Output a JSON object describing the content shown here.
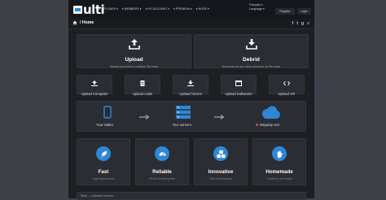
{
  "header": {
    "logo_text": "ulti",
    "nav": [
      "▾ UPLOADS ▾",
      "▾ MEMBERS ▾",
      "▾ MY ACCOUNT ▾",
      "▾ PREMIUM ▾",
      "▾ MORE ▾"
    ],
    "language": [
      "Français ▾",
      "Language ▾"
    ],
    "register_label": "Register",
    "login_label": "Login"
  },
  "breadcrumb": {
    "text": "/ Home"
  },
  "social": [
    "f",
    "t",
    "g",
    "≡"
  ],
  "upload": {
    "title": "Upload",
    "subtitle": "Upload your files to multiple file-hosts"
  },
  "debrid": {
    "title": "Debrid",
    "subtitle": "Download as you were premium on file-hosts"
  },
  "upload_options": [
    {
      "label": "Upload Computer",
      "icon": "upload-icon"
    },
    {
      "label": "Upload Links",
      "icon": "document-icon"
    },
    {
      "label": "Upload Torrent",
      "icon": "download-icon"
    },
    {
      "label": "Upload Softwares",
      "icon": "window-icon"
    },
    {
      "label": "Upload API",
      "icon": "code-icon"
    }
  ],
  "flow": {
    "tablet": "Your tablet",
    "servers": "Our servers",
    "host": "MegaUp.net"
  },
  "features": [
    {
      "title": "Fast",
      "subtitle": "Huge infrastructure",
      "icon": "rocket-icon"
    },
    {
      "title": "Reliable",
      "subtitle": "99.99% service uptime",
      "icon": "speedometer-icon"
    },
    {
      "title": "Innovative",
      "subtitle": "Find out all features",
      "icon": "cubes-icon"
    },
    {
      "title": "Homemade",
      "subtitle": "Created by our friends",
      "icon": "hand-icon"
    }
  ],
  "footer": {
    "text": "Stats — selected servers"
  },
  "colors": {
    "accent": "#2f86d6",
    "panel": "#2a2d33",
    "page": "#1d1f23",
    "status_dot": "#e04848"
  }
}
